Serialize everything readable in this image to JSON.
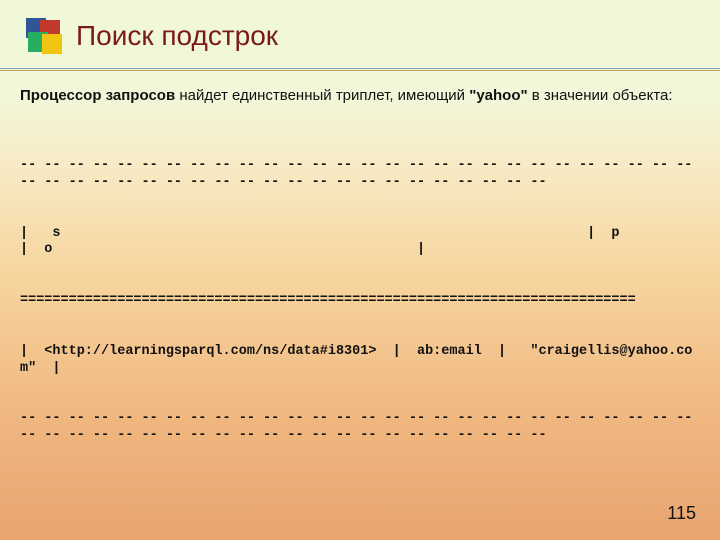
{
  "title": "Поиск  подстрок",
  "intro_lead": "Процессор запросов",
  "intro_rest": " найдет единственный триплет, имеющий ",
  "intro_bold2": "\"yahoo\"",
  "intro_tail": " в значении  объекта:",
  "table_dash_line": "-- -- -- -- -- -- -- -- -- -- -- -- -- -- -- -- -- -- -- -- -- -- -- -- -- -- -- -- -- -- -- -- -- -- -- -- -- -- -- -- -- -- -- -- -- -- -- -- -- --",
  "table_header": "|   s                                                                 |  p              |  o                                             |",
  "table_eq_line": "============================================================================",
  "table_row": "|  <http://learningsparql.com/ns/data#i8301>  |  ab:email  |   \"craigellis@yahoo.com\"  |",
  "page_number": "115"
}
